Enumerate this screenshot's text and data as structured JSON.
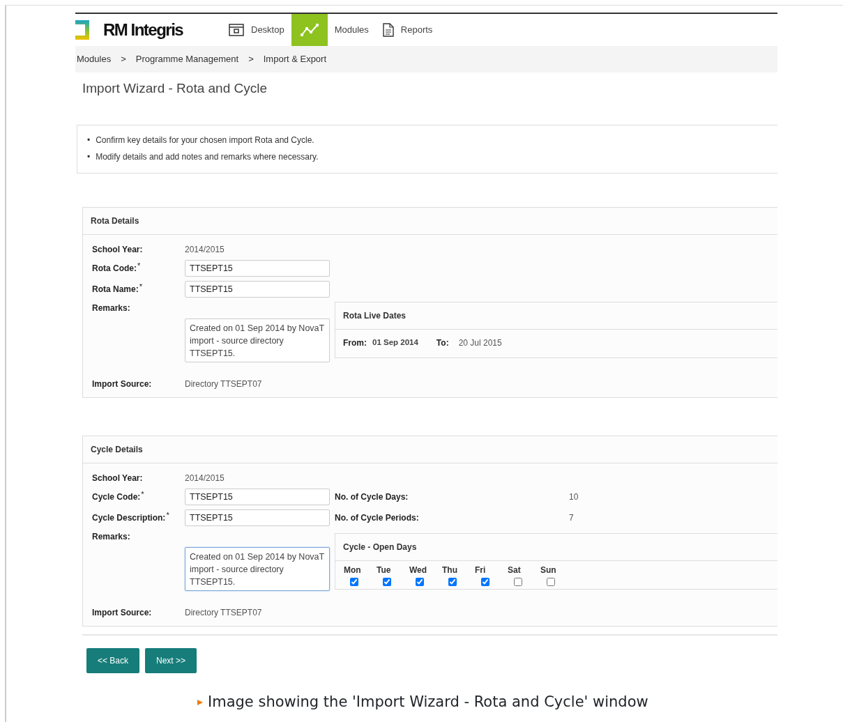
{
  "app": {
    "logo": "RM Integris",
    "nav": [
      {
        "kind": "desktop",
        "label": "Desktop",
        "selected": false
      },
      {
        "kind": "chart",
        "selected": true
      },
      {
        "kind": "plain",
        "label": "Modules",
        "selected": false
      },
      {
        "kind": "document",
        "label": "Reports",
        "selected": false
      }
    ],
    "breadcrumb": [
      "Modules",
      "Programme Management",
      "Import & Export"
    ],
    "breadcrumb_separator": ">",
    "page_title": "Import Wizard - Rota and Cycle",
    "instructions": [
      {
        "bullet": "•",
        "text": "Confirm key details for your chosen import Rota and Cycle."
      },
      {
        "bullet": "•",
        "text": "Modify details and add notes and remarks where necessary."
      }
    ],
    "rota_details": {
      "title": "Rota Details",
      "fields": [
        {
          "label": "School Year:",
          "kind": "text",
          "value": "2014/2015"
        },
        {
          "label": "Rota Code:",
          "required_mark": "*",
          "kind": "input",
          "value": "TTSEPT15"
        },
        {
          "label": "Rota Name:",
          "required_mark": "*",
          "kind": "input",
          "value": "TTSEPT15"
        },
        {
          "label": "Remarks:",
          "kind": "textarea",
          "value": "Created on 01 Sep 2014 by NovaT import - source directory TTSEPT15.",
          "focused": false
        },
        {
          "label": "Import Source:",
          "kind": "text",
          "value": "Directory TTSEPT07"
        }
      ],
      "live_dates": {
        "title": "Rota Live Dates",
        "from_label": "From:",
        "from_value": "01 Sep 2014",
        "to_label": "To:",
        "to_value": "20 Jul 2015"
      }
    },
    "cycle_details": {
      "title": "Cycle Details",
      "fields": [
        {
          "label": "School Year:",
          "kind": "text",
          "value": "2014/2015"
        },
        {
          "label": "Cycle Code:",
          "required_mark": "*",
          "kind": "input",
          "value": "TTSEPT15"
        },
        {
          "label": "Cycle Description:",
          "required_mark": "*",
          "kind": "input",
          "value": "TTSEPT15"
        },
        {
          "label": "Remarks:",
          "kind": "textarea",
          "value": "Created on 01 Sep 2014 by NovaT import - source directory TTSEPT15.",
          "focused": true
        },
        {
          "label": "Import Source:",
          "kind": "text",
          "value": "Directory TTSEPT07"
        }
      ],
      "stats": [
        {
          "label": "No. of Cycle Days:",
          "value": "10"
        },
        {
          "label": "No. of Cycle Periods:",
          "value": "7"
        }
      ],
      "open_days": {
        "title": "Cycle - Open Days",
        "days": [
          {
            "label": "Mon",
            "checked": true
          },
          {
            "label": "Tue",
            "checked": true
          },
          {
            "label": "Wed",
            "checked": true
          },
          {
            "label": "Thu",
            "checked": true
          },
          {
            "label": "Fri",
            "checked": true
          },
          {
            "label": "Sat",
            "checked": false
          },
          {
            "label": "Sun",
            "checked": false
          }
        ]
      }
    },
    "buttons": [
      "<< Back",
      "Next >>"
    ]
  },
  "caption": "Image showing the 'Import Wizard - Rota and Cycle' window"
}
